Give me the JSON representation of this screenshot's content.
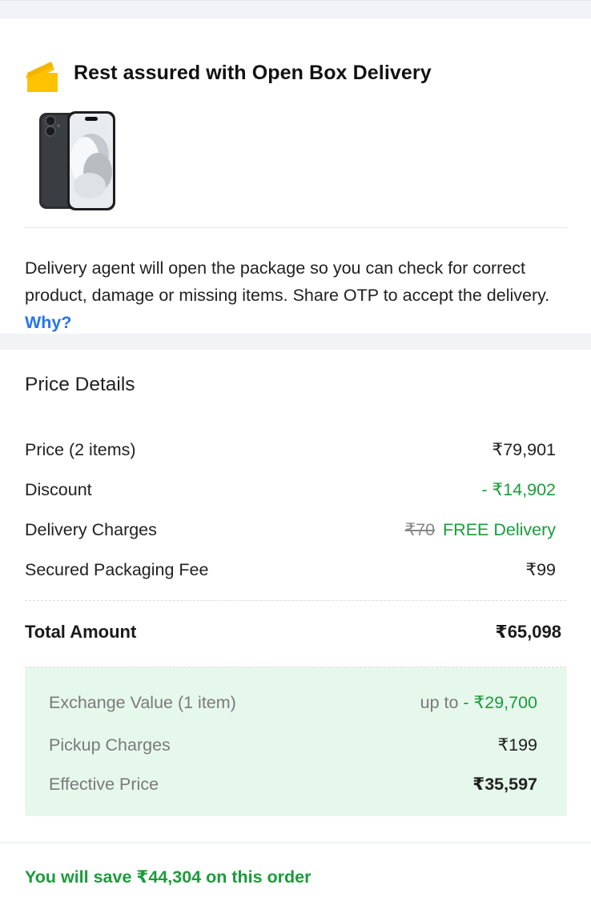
{
  "open_box": {
    "title": "Rest assured with Open Box Delivery",
    "description": "Delivery agent will open the package so you can check for correct product, damage or missing items. Share OTP to accept the delivery.",
    "why_link": "Why?",
    "icon": "open-box-icon",
    "product_image": "iphone-product-image"
  },
  "price_details": {
    "title": "Price Details",
    "rows": [
      {
        "label": "Price (2 items)",
        "value": "₹79,901"
      },
      {
        "label": "Discount",
        "value": "- ₹14,902"
      },
      {
        "label": "Delivery Charges",
        "old_value": "₹70",
        "value": "FREE Delivery"
      },
      {
        "label": "Secured Packaging Fee",
        "value": "₹99"
      }
    ],
    "total": {
      "label": "Total Amount",
      "value": "₹65,098"
    }
  },
  "exchange": {
    "rows": [
      {
        "label": "Exchange Value (1 item)",
        "prefix": "up to",
        "value": "- ₹29,700"
      },
      {
        "label": "Pickup Charges",
        "value": "₹199"
      },
      {
        "label": "Effective Price",
        "value": "₹35,597"
      }
    ]
  },
  "savings": {
    "text": "You will save ₹44,304 on this order"
  },
  "colors": {
    "green": "#1a9c3a",
    "link": "#2874f0",
    "exchange_bg": "#e6f7ec",
    "box_icon": "#ffc200"
  }
}
